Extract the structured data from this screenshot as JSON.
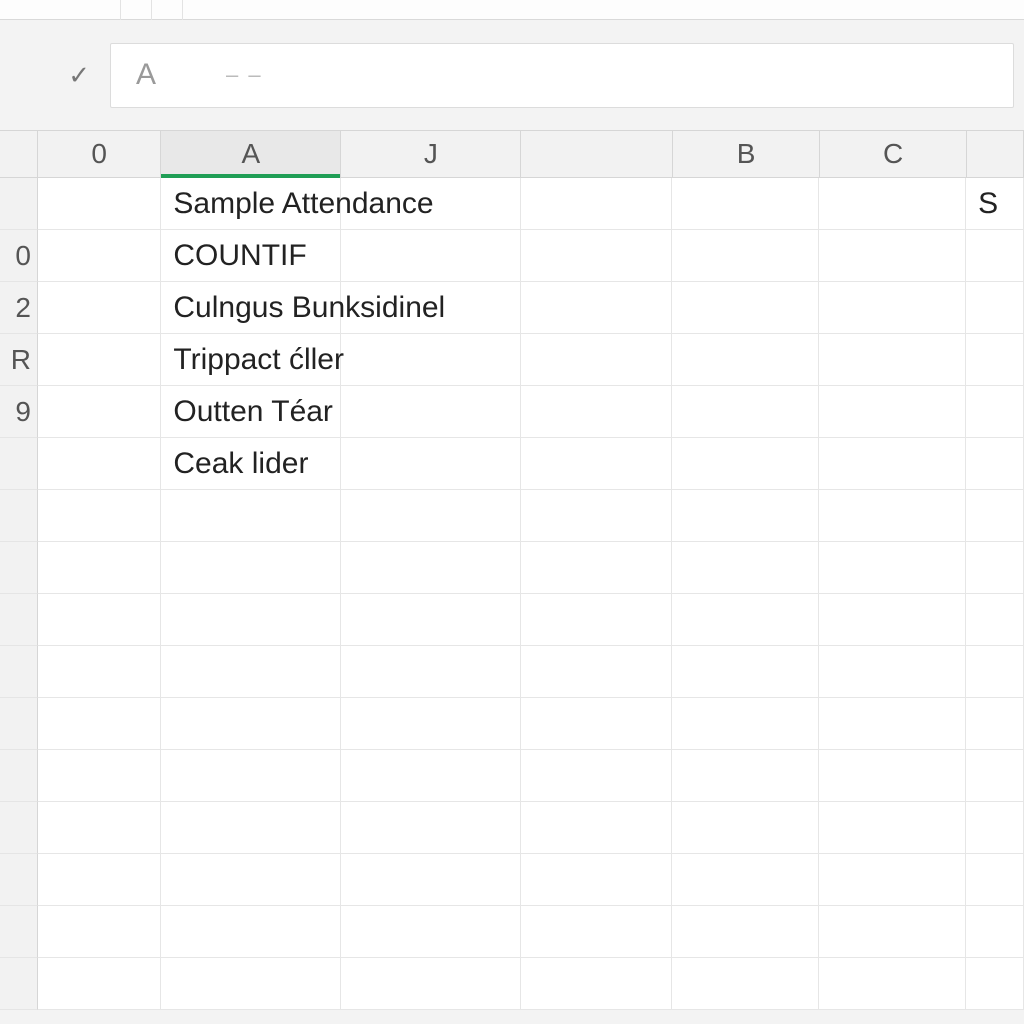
{
  "formula_bar": {
    "check": "✓",
    "fx_glyph": "A",
    "dash": "– –"
  },
  "columns": {
    "gap": "0",
    "A": "A",
    "J": "J",
    "B": "B",
    "C": "C"
  },
  "row_headers": [
    "",
    "0",
    "2",
    "R",
    "9",
    ""
  ],
  "cells_colA": [
    "Sample Attendance",
    "COUNTIF",
    "Culngus Bunksidinel",
    "Trippact ćller",
    "Outten Téar",
    "Ceak lider"
  ],
  "cells_right_edge": [
    "S",
    "",
    "",
    "",
    "",
    ""
  ]
}
